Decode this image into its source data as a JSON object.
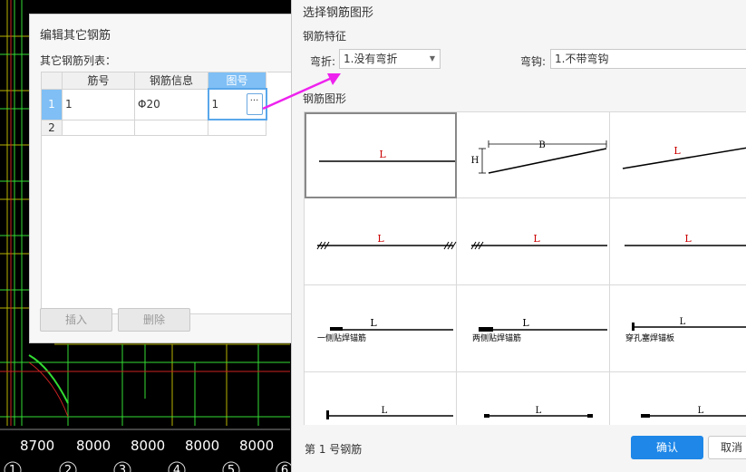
{
  "cad": {
    "axis_dims": [
      "8700",
      "8000",
      "8000",
      "8000",
      "8000"
    ],
    "axis_numbers": [
      "1",
      "2",
      "3",
      "4",
      "5",
      "6"
    ]
  },
  "edit_dialog": {
    "title": "编辑其它钢筋",
    "list_label": "其它钢筋列表：",
    "columns": [
      "筋号",
      "钢筋信息",
      "图号"
    ],
    "rows": [
      {
        "index": "1",
        "bar_no": "1",
        "info": "Φ20",
        "shape_no": "1"
      },
      {
        "index": "2",
        "bar_no": "",
        "info": "",
        "shape_no": ""
      }
    ],
    "browse_label": "···",
    "insert_button": "插入",
    "delete_button": "删除"
  },
  "shape_dialog": {
    "title": "选择钢筋图形",
    "feature_section": "钢筋特征",
    "bend_label": "弯折:",
    "bend_value": "1.没有弯折",
    "hook_label": "弯钩:",
    "hook_value": "1.不带弯钩",
    "shape_section": "钢筋图形",
    "shapes": [
      {
        "label": "L",
        "caption": ""
      },
      {
        "label": "B",
        "label2": "H",
        "caption": ""
      },
      {
        "label": "L",
        "caption": ""
      },
      {
        "label": "L",
        "caption": ""
      },
      {
        "label": "L",
        "caption": ""
      },
      {
        "label": "L",
        "caption": ""
      },
      {
        "label": "L",
        "caption": "一侧贴焊锚筋"
      },
      {
        "label": "L",
        "caption": "两侧贴焊锚筋"
      },
      {
        "label": "L",
        "caption": "穿孔塞焊锚板"
      },
      {
        "label": "L",
        "caption": ""
      },
      {
        "label": "L",
        "caption": ""
      },
      {
        "label": "L",
        "caption": ""
      }
    ],
    "status_text": "第 1 号钢筋",
    "ok_button": "确认",
    "cancel_button": "取消"
  },
  "colors": {
    "accent": "#1e87e8",
    "header_selected": "#7fbff5",
    "red_label": "#cc0000",
    "arrow": "#ee22ee"
  }
}
